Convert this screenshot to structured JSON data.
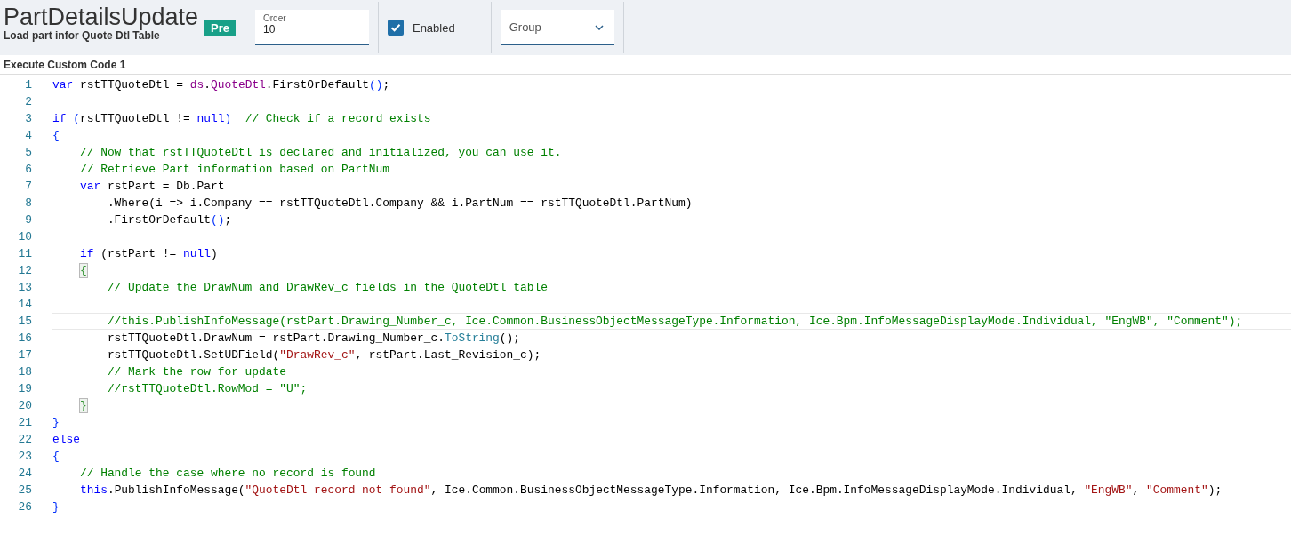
{
  "header": {
    "title": "PartDetailsUpdate",
    "subtitle": "Load part infor Quote Dtl Table",
    "badge": "Pre",
    "order": {
      "label": "Order",
      "value": "10"
    },
    "enabled": {
      "label": "Enabled",
      "checked": true
    },
    "group": {
      "placeholder": "Group"
    }
  },
  "section_title": "Execute Custom Code 1",
  "code_lines": [
    {
      "number": "1",
      "tokens": [
        {
          "kind": "keyword",
          "text": "var"
        },
        {
          "kind": "plain",
          "text": " rstTTQuoteDtl = "
        },
        {
          "kind": "member",
          "text": "ds"
        },
        {
          "kind": "plain",
          "text": "."
        },
        {
          "kind": "member",
          "text": "QuoteDtl"
        },
        {
          "kind": "plain",
          "text": ".FirstOrDefault"
        },
        {
          "kind": "bracket",
          "text": "()"
        },
        {
          "kind": "plain",
          "text": ";"
        }
      ]
    },
    {
      "number": "2"
    },
    {
      "number": "3",
      "tokens": [
        {
          "kind": "keyword",
          "text": "if"
        },
        {
          "kind": "bracket",
          "text": " ("
        },
        {
          "kind": "plain",
          "text": "rstTTQuoteDtl != "
        },
        {
          "kind": "keyword",
          "text": "null"
        },
        {
          "kind": "bracket",
          "text": ")"
        },
        {
          "kind": "comment",
          "text": "  // Check if a record exists"
        }
      ]
    },
    {
      "number": "4",
      "tokens": [
        {
          "kind": "bracket",
          "text": "{"
        }
      ]
    },
    {
      "number": "5",
      "tokens": [
        {
          "kind": "comment",
          "text": "    // Now that rstTTQuoteDtl is declared and initialized, you can use it."
        }
      ]
    },
    {
      "number": "6",
      "tokens": [
        {
          "kind": "comment",
          "text": "    // Retrieve Part information based on PartNum"
        }
      ]
    },
    {
      "number": "7",
      "tokens": [
        {
          "kind": "keyword",
          "text": "    var"
        },
        {
          "kind": "plain",
          "text": " rstPart = Db.Part"
        }
      ]
    },
    {
      "number": "8",
      "tokens": [
        {
          "kind": "plain",
          "text": "        .Where(i => i.Company == rstTTQuoteDtl.Company && i.PartNum == rstTTQuoteDtl.PartNum)"
        }
      ]
    },
    {
      "number": "9",
      "tokens": [
        {
          "kind": "plain",
          "text": "        .FirstOrDefault"
        },
        {
          "kind": "bracket",
          "text": "()"
        },
        {
          "kind": "plain",
          "text": ";"
        }
      ]
    },
    {
      "number": "10"
    },
    {
      "number": "11",
      "tokens": [
        {
          "kind": "keyword",
          "text": "    if"
        },
        {
          "kind": "plain",
          "text": " (rstPart != "
        },
        {
          "kind": "keyword",
          "text": "null"
        },
        {
          "kind": "plain",
          "text": ")"
        }
      ]
    },
    {
      "number": "12",
      "tokens": [
        {
          "kind": "brace-match",
          "text": "    {"
        }
      ]
    },
    {
      "number": "13",
      "tokens": [
        {
          "kind": "comment",
          "text": "        // Update the DrawNum and DrawRev_c fields in the QuoteDtl table"
        }
      ]
    },
    {
      "number": "14"
    },
    {
      "number": "15",
      "current": true,
      "tokens": [
        {
          "kind": "comment",
          "text": "        //this.PublishInfoMessage(rstPart.Drawing_Number_c, Ice.Common.BusinessObjectMessageType.Information, Ice.Bpm.InfoMessageDisplayMode.Individual, \"EngWB\", \"Comment\");"
        }
      ]
    },
    {
      "number": "16",
      "tokens": [
        {
          "kind": "plain",
          "text": "        rstTTQuoteDtl.DrawNum = rstPart.Drawing_Number_c."
        },
        {
          "kind": "method",
          "text": "ToString"
        },
        {
          "kind": "plain",
          "text": "();"
        }
      ]
    },
    {
      "number": "17",
      "tokens": [
        {
          "kind": "plain",
          "text": "        rstTTQuoteDtl.SetUDField("
        },
        {
          "kind": "string",
          "text": "\"DrawRev_c\""
        },
        {
          "kind": "plain",
          "text": ", rstPart.Last_Revision_c);"
        }
      ]
    },
    {
      "number": "18",
      "tokens": [
        {
          "kind": "comment",
          "text": "        // Mark the row for update"
        }
      ]
    },
    {
      "number": "19",
      "tokens": [
        {
          "kind": "comment",
          "text": "        //rstTTQuoteDtl.RowMod = \"U\";"
        }
      ]
    },
    {
      "number": "20",
      "tokens": [
        {
          "kind": "brace-match",
          "text": "    }"
        }
      ]
    },
    {
      "number": "21",
      "tokens": [
        {
          "kind": "bracket",
          "text": "}"
        }
      ]
    },
    {
      "number": "22",
      "tokens": [
        {
          "kind": "keyword",
          "text": "else"
        }
      ]
    },
    {
      "number": "23",
      "tokens": [
        {
          "kind": "bracket",
          "text": "{"
        }
      ]
    },
    {
      "number": "24",
      "tokens": [
        {
          "kind": "comment",
          "text": "    // Handle the case where no record is found"
        }
      ]
    },
    {
      "number": "25",
      "tokens": [
        {
          "kind": "keyword",
          "text": "    this"
        },
        {
          "kind": "plain",
          "text": ".PublishInfoMessage("
        },
        {
          "kind": "string",
          "text": "\"QuoteDtl record not found\""
        },
        {
          "kind": "plain",
          "text": ", Ice.Common.BusinessObjectMessageType.Information, Ice.Bpm.InfoMessageDisplayMode.Individual, "
        },
        {
          "kind": "string",
          "text": "\"EngWB\""
        },
        {
          "kind": "plain",
          "text": ", "
        },
        {
          "kind": "string",
          "text": "\"Comment\""
        },
        {
          "kind": "plain",
          "text": ");"
        }
      ]
    },
    {
      "number": "26",
      "tokens": [
        {
          "kind": "bracket",
          "text": "}"
        }
      ]
    }
  ]
}
